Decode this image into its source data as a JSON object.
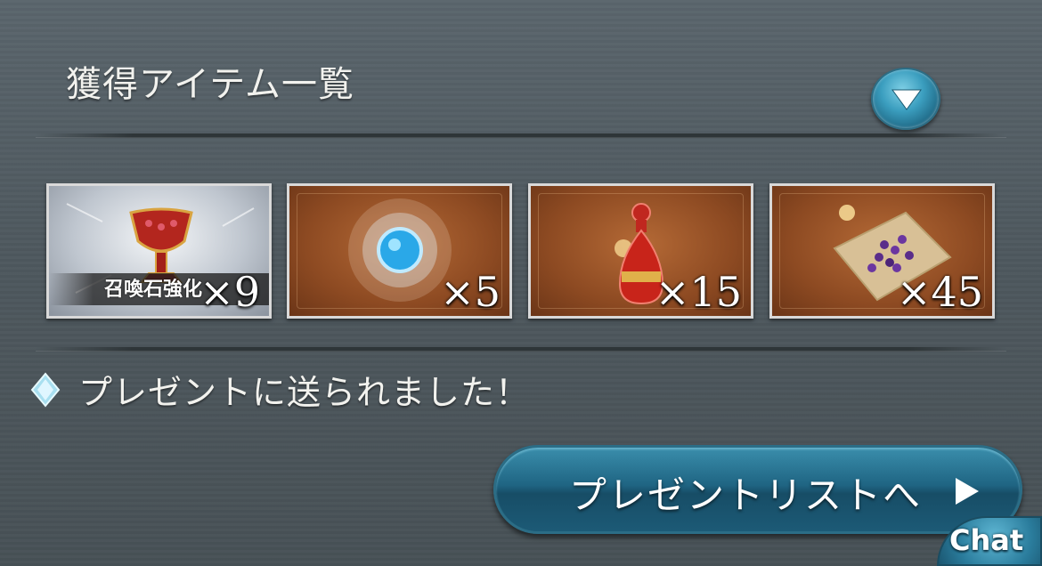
{
  "header": {
    "title": "獲得アイテム一覧",
    "toggle_icon": "chevron-down-icon"
  },
  "items": [
    {
      "name": "召喚石強化",
      "quantity": "×9",
      "icon": "chalice-icon"
    },
    {
      "name": "",
      "quantity": "×5",
      "icon": "blue-gem-icon"
    },
    {
      "name": "",
      "quantity": "×15",
      "icon": "red-potion-icon"
    },
    {
      "name": "",
      "quantity": "×45",
      "icon": "purple-seeds-icon"
    }
  ],
  "notice": {
    "icon": "diamond-icon",
    "text": "プレゼントに送られました！"
  },
  "present_button": {
    "label": "プレゼントリストへ",
    "icon": "play-arrow-icon"
  },
  "chat_button": {
    "label": "Chat"
  },
  "colors": {
    "background": "#525c62",
    "accent": "#1f6482",
    "item_frame_brown": "#8d4a22"
  }
}
